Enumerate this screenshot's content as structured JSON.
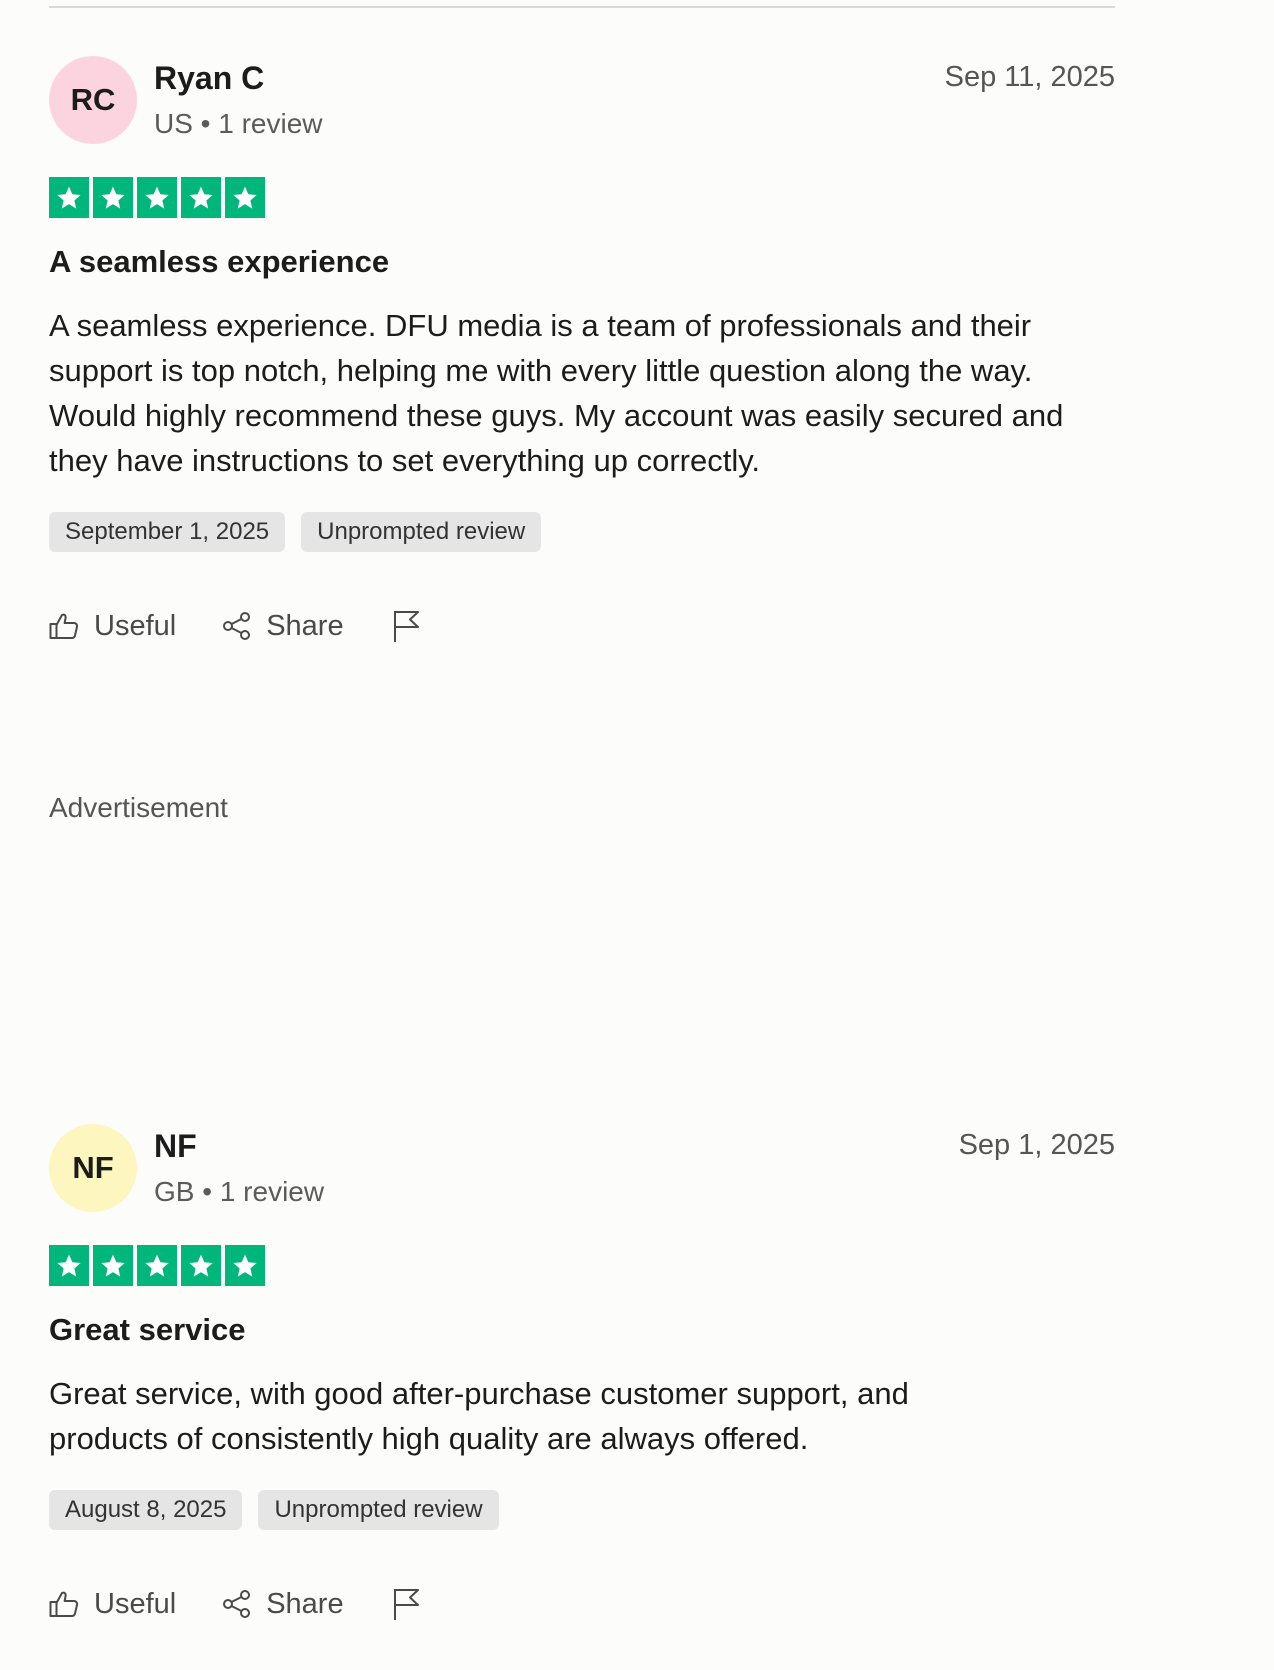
{
  "advertisement_label": "Advertisement",
  "colors": {
    "star_green": "#00b67a",
    "tag_bg": "#e5e5e5"
  },
  "reviews": [
    {
      "initials": "RC",
      "avatar_color": "#fcd4df",
      "name": "Ryan C",
      "meta": "US • 1 review",
      "date": "Sep 11, 2025",
      "rating": 5,
      "title": "A seamless experience",
      "body": "A seamless experience. DFU media is a team of professionals and their support is top notch, helping me with every little question along the way. Would highly recommend these guys. My account was easily secured and they have instructions to set everything up correctly.",
      "experience_date": "September 1, 2025",
      "tag": "Unprompted review",
      "useful_label": "Useful",
      "share_label": "Share"
    },
    {
      "initials": "NF",
      "avatar_color": "#fdf6bf",
      "name": "NF",
      "meta": "GB • 1 review",
      "date": "Sep 1, 2025",
      "rating": 5,
      "title": "Great service",
      "body": "Great service, with good after-purchase customer support, and products of consistently high quality are always offered.",
      "experience_date": "August 8, 2025",
      "tag": "Unprompted review",
      "useful_label": "Useful",
      "share_label": "Share"
    }
  ]
}
